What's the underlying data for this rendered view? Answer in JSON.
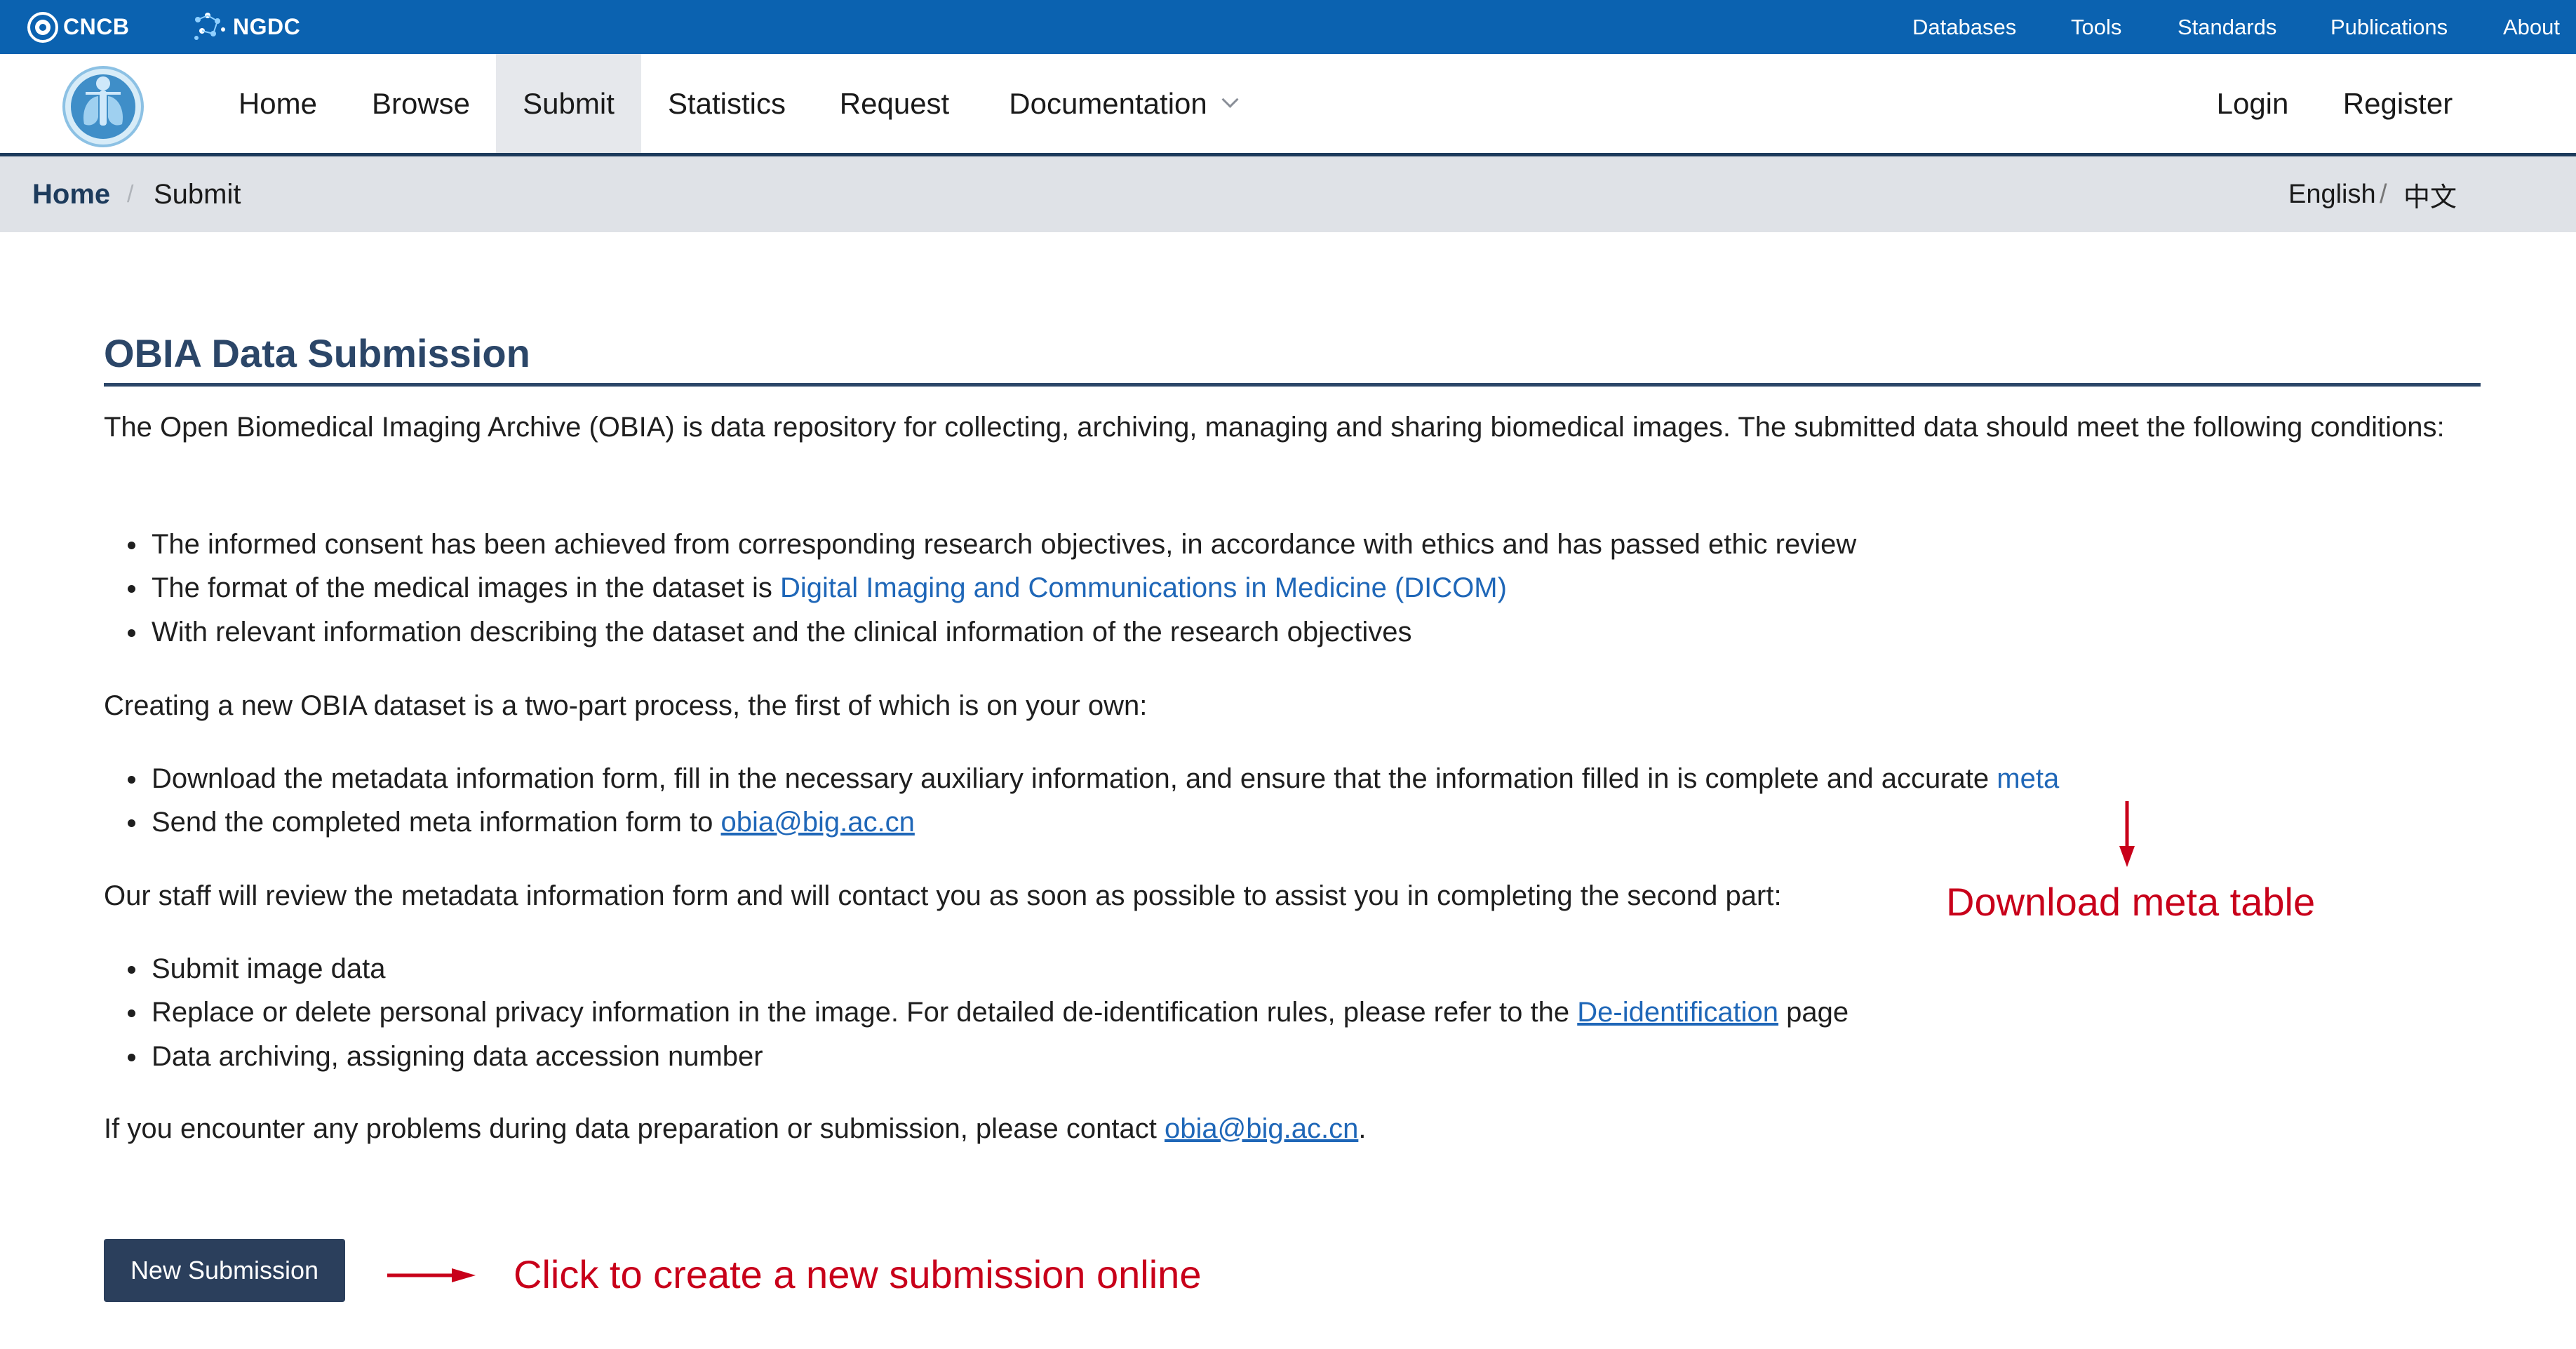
{
  "topbar": {
    "brand_cncb": "CNCB",
    "brand_ngdc": "NGDC",
    "links": [
      "Databases",
      "Tools",
      "Standards",
      "Publications",
      "About"
    ]
  },
  "nav": {
    "logo_icon": "lung-scan-logo-icon",
    "items": [
      "Home",
      "Browse",
      "Submit",
      "Statistics",
      "Request",
      "Documentation"
    ],
    "active": "Submit",
    "login": "Login",
    "register": "Register"
  },
  "breadcrumb": {
    "home": "Home",
    "separator": "/",
    "current": "Submit",
    "lang_en": "English",
    "lang_sep": "/",
    "lang_zh": "中文"
  },
  "main": {
    "title": "OBIA Data Submission",
    "intro": "The Open Biomedical Imaging Archive (OBIA) is data repository for collecting, archiving, managing and sharing biomedical images. The submitted data should meet the following conditions:",
    "conditions": {
      "item1": "The informed consent has been achieved from corresponding research objectives, in accordance with ethics and has passed ethic review",
      "item2_prefix": "The format of the medical images in the dataset is ",
      "item2_link": "Digital Imaging and Communications in Medicine (DICOM)",
      "item3": "With relevant information describing the dataset and the clinical information of the research objectives"
    },
    "part1_intro": "Creating a new OBIA dataset is a two-part process, the first of which is on your own:",
    "part1": {
      "item1_prefix": "Download the metadata information form, fill in the necessary auxiliary information, and ensure that the information filled in is complete and accurate ",
      "item1_link": "meta",
      "item2_prefix": "Send the completed meta information form to ",
      "item2_link": "obia@big.ac.cn"
    },
    "part2_intro": "Our staff will review the metadata information form and will contact you as soon as possible to assist you in completing the second part:",
    "part2": {
      "item1": "Submit image data",
      "item2_prefix": "Replace or delete personal privacy information in the image. For detailed de-identification rules, please refer to the ",
      "item2_link": "De-identification",
      "item2_suffix": " page",
      "item3": "Data archiving, assigning data accession number"
    },
    "contact_prefix": "If you encounter any problems during data preparation or submission, please contact ",
    "contact_link": "obia@big.ac.cn",
    "contact_suffix": ".",
    "button": "New Submission"
  },
  "annotations": {
    "download_meta": "Download meta table",
    "click_create": "Click to create a new submission online",
    "color": "#c8001a"
  },
  "colors": {
    "topbar": "#0b62b0",
    "nav_border": "#1d3b5c",
    "title": "#2b4668",
    "link": "#1f67b8",
    "button": "#2b3f5c",
    "breadcrumb_bg": "#dfe2e7"
  }
}
